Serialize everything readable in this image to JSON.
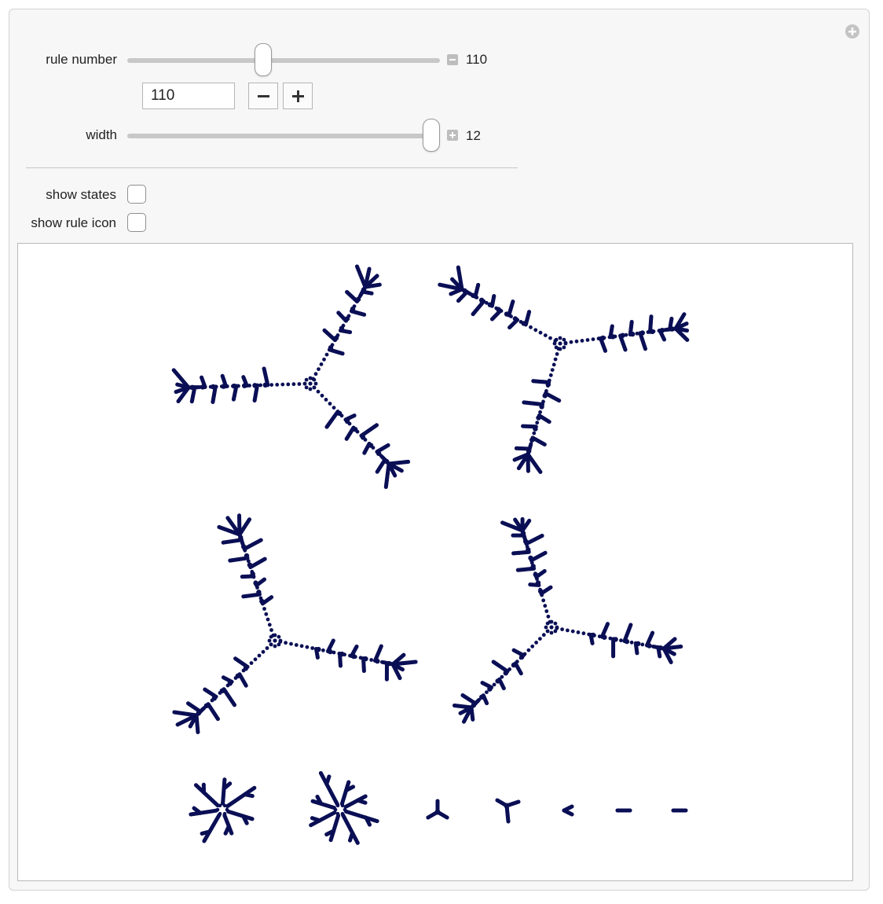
{
  "controls": {
    "rule_number": {
      "label": "rule number",
      "value": "110",
      "input_value": "110",
      "min": 0,
      "max": 255
    },
    "width": {
      "label": "width",
      "value": "12"
    },
    "show_states": {
      "label": "show states",
      "checked": false
    },
    "show_rule_icon": {
      "label": "show rule icon",
      "checked": false
    }
  },
  "icons": {
    "corner": "plus-circle-icon",
    "rule_minus": "minus-box-icon",
    "width_plus": "plus-box-icon",
    "decrement": "minus-icon",
    "increment": "plus-icon"
  },
  "colors": {
    "node": "#0a0f55",
    "edge": "#0a0f55",
    "panel": "#f7f7f7",
    "track": "#c8c8c8"
  },
  "graph": {
    "description_of_components": "state transition graphs of rule 110 on width-12 cyclic lattice",
    "large_components": 4,
    "small_components": 7
  }
}
